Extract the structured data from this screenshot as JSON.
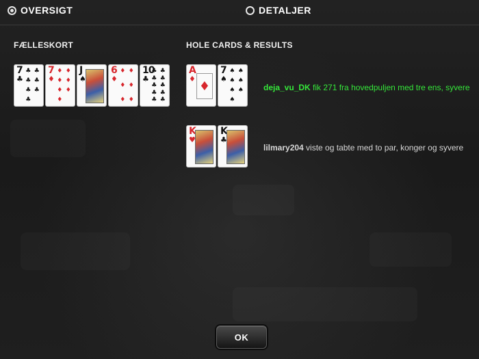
{
  "tabs": [
    {
      "label": "OVERSIGT",
      "selected": true
    },
    {
      "label": "DETALJER",
      "selected": false
    }
  ],
  "community": {
    "title": "FÆLLESKORT",
    "cards": [
      {
        "rank": "7",
        "suit": "♣",
        "color": "black"
      },
      {
        "rank": "7",
        "suit": "♦",
        "color": "red"
      },
      {
        "rank": "J",
        "suit": "♠",
        "color": "black"
      },
      {
        "rank": "6",
        "suit": "♦",
        "color": "red"
      },
      {
        "rank": "10",
        "suit": "♣",
        "color": "black"
      }
    ]
  },
  "holes": {
    "title": "HOLE CARDS & RESULTS",
    "players": [
      {
        "cards": [
          {
            "rank": "A",
            "suit": "♦",
            "color": "red"
          },
          {
            "rank": "7",
            "suit": "♠",
            "color": "black"
          }
        ],
        "name": "deja_vu_DK",
        "text": " fik 271 fra hovedpuljen med tre ens, syvere",
        "status": "win"
      },
      {
        "cards": [
          {
            "rank": "K",
            "suit": "♥",
            "color": "red"
          },
          {
            "rank": "K",
            "suit": "♣",
            "color": "black"
          }
        ],
        "name": "lilmary204",
        "text": " viste og tabte med to par, konger og syvere",
        "status": "lose"
      }
    ]
  },
  "ok_label": "OK",
  "colors": {
    "win": "#35e83a",
    "red_suit": "#d7262c",
    "background": "#1c1c1c"
  }
}
